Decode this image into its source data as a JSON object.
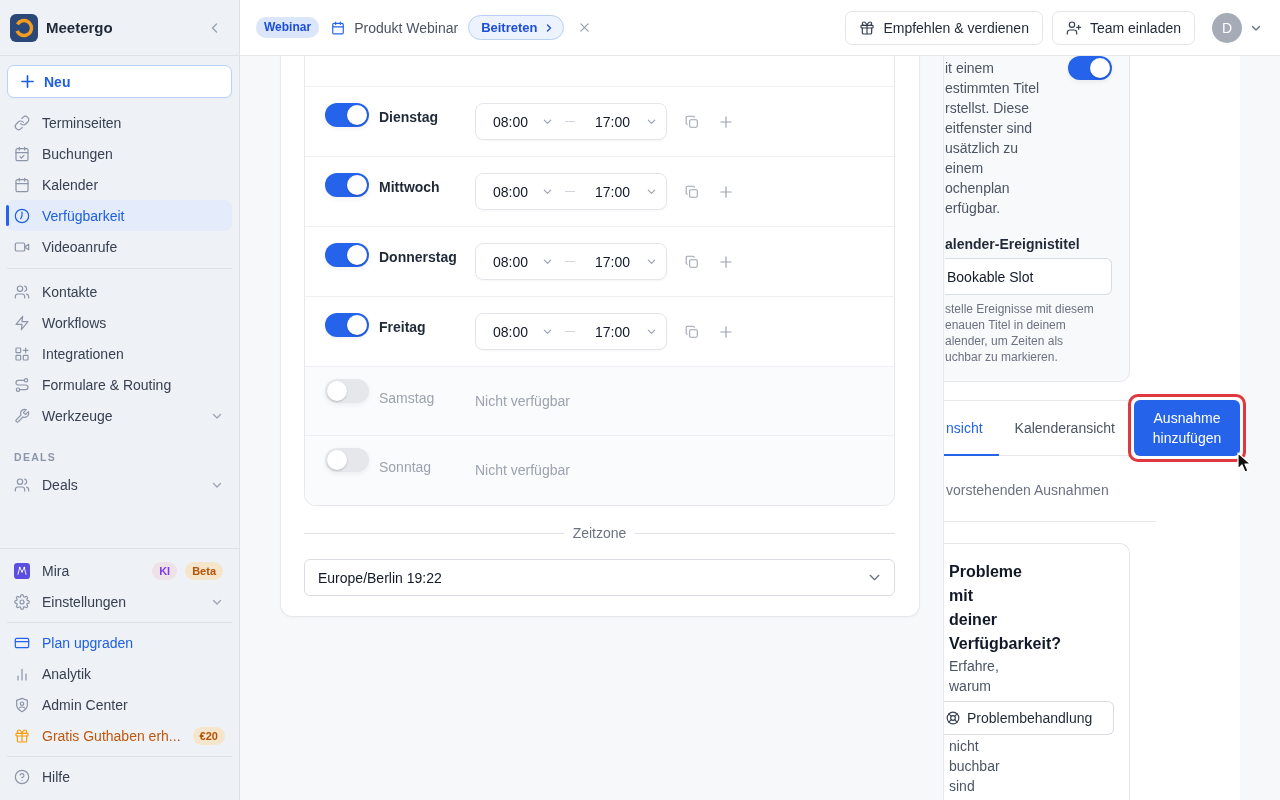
{
  "sidebar": {
    "brand": "Meetergo",
    "new_button": "Neu",
    "nav_groups": [
      {
        "items": [
          {
            "label": "Terminseiten",
            "kind": "link",
            "selected": false
          },
          {
            "label": "Buchungen",
            "kind": "link",
            "selected": false
          },
          {
            "label": "Kalender",
            "kind": "link",
            "selected": false
          },
          {
            "label": "Verfügbarkeit",
            "kind": "link",
            "selected": true
          },
          {
            "label": "Videoanrufe",
            "kind": "link",
            "selected": false
          }
        ]
      },
      {
        "items": [
          {
            "label": "Kontakte",
            "kind": "link",
            "selected": false
          },
          {
            "label": "Workflows",
            "kind": "link",
            "selected": false
          },
          {
            "label": "Integrationen",
            "kind": "link",
            "selected": false
          },
          {
            "label": "Formulare & Routing",
            "kind": "link",
            "selected": false
          },
          {
            "label": "Werkzeuge",
            "kind": "menu",
            "selected": false,
            "expanded": false
          }
        ]
      },
      {
        "heading": "DEALS",
        "items": [
          {
            "label": "Deals",
            "kind": "menu",
            "selected": false,
            "expanded": false
          }
        ]
      }
    ],
    "footer_groups": [
      {
        "items": [
          {
            "label": "Mira",
            "kind": "link",
            "selected": false,
            "badges": [
              {
                "text": "KI",
                "color": "#7c3aed"
              },
              {
                "text": "Beta",
                "color": "#b45309"
              }
            ]
          },
          {
            "label": "Einstellungen",
            "kind": "menu",
            "selected": false,
            "expanded": false
          }
        ]
      },
      {
        "items": [
          {
            "label": "Plan upgraden",
            "kind": "upgrade",
            "selected": false
          },
          {
            "label": "Analytik",
            "kind": "link",
            "selected": false
          },
          {
            "label": "Admin Center",
            "kind": "link",
            "selected": false
          },
          {
            "label": "Gratis Guthaben erh...",
            "kind": "promo",
            "selected": false,
            "badges": [
              {
                "text": "€20",
                "color": "#b45309"
              }
            ]
          }
        ]
      },
      {
        "items": [
          {
            "label": "Hilfe",
            "kind": "link",
            "selected": false
          }
        ]
      }
    ]
  },
  "top_bar": {
    "event_type": "Webinar",
    "event_title": "Produkt Webinar",
    "join_button": "Beitreten",
    "actions": [
      "Empfehlen & verdienen",
      "Team einladen"
    ],
    "avatar_initial": "D"
  },
  "schedule": {
    "days": [
      {
        "name": "Dienstag",
        "on": true,
        "start": "08:00",
        "end": "17:00"
      },
      {
        "name": "Mittwoch",
        "on": true,
        "start": "08:00",
        "end": "17:00"
      },
      {
        "name": "Donnerstag",
        "on": true,
        "start": "08:00",
        "end": "17:00"
      },
      {
        "name": "Freitag",
        "on": true,
        "start": "08:00",
        "end": "17:00"
      },
      {
        "name": "Samstag",
        "on": false,
        "note": "Nicht verfügbar"
      },
      {
        "name": "Sonntag",
        "on": false,
        "note": "Nicht verfügbar"
      }
    ],
    "timezone_label": "Zeitzone",
    "timezone": "Europe/Berlin 19:22"
  },
  "bookable_slots": {
    "on": true,
    "description_lines": [
      "it einem",
      "estimmten Titel",
      "rstellst. Diese",
      "eitfenster sind",
      "usätzlich zu",
      "einem",
      "ochenplan",
      "erfügbar."
    ],
    "field_label": "alender-Ereignistitel",
    "field_value": "Bookable Slot",
    "hint_lines": [
      "stelle Ereignisse mit diesem",
      "enauen Titel in deinem",
      "alender, um Zeiten als",
      "uchbar zu markieren."
    ]
  },
  "exceptions": {
    "tabs": [
      {
        "label": "nsicht",
        "selected": true
      },
      {
        "label": "Kalenderansicht",
        "selected": false
      }
    ],
    "add_button": "Ausnahme hinzufügen",
    "highlighted": true,
    "empty_text": "vorstehenden Ausnahmen"
  },
  "help_card": {
    "title": "Probleme mit deiner Verfügbarkeit?",
    "text_before": "Erfahre, warum",
    "button": "Problembehandlung",
    "text_after": "nicht buchbar sind"
  }
}
